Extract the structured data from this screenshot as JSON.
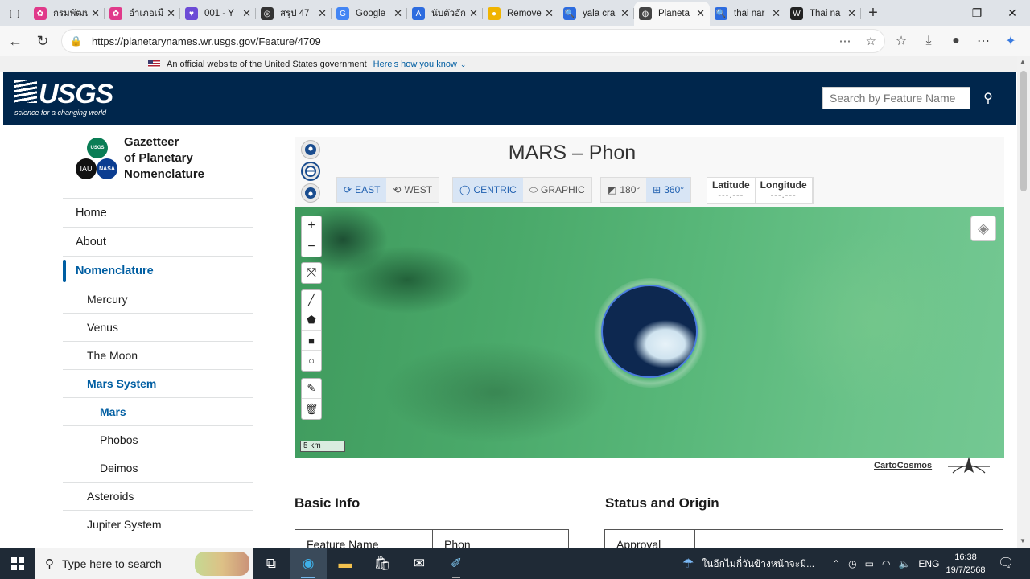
{
  "browser": {
    "tabs": [
      {
        "title": "กรมพัฒนา",
        "fav_color": "#e03a8a",
        "fav_glyph": "✿"
      },
      {
        "title": "อำเภอเมือง",
        "fav_color": "#e03a8a",
        "fav_glyph": "✿"
      },
      {
        "title": "001 - Y",
        "fav_color": "#6c4bd6",
        "fav_glyph": "♥"
      },
      {
        "title": "สรุป 47",
        "fav_color": "#333333",
        "fav_glyph": "◎"
      },
      {
        "title": "Google",
        "fav_color": "#4285f4",
        "fav_glyph": "G"
      },
      {
        "title": "นับตัวอักษร",
        "fav_color": "#2d6cdf",
        "fav_glyph": "A"
      },
      {
        "title": "Remove",
        "fav_color": "#f0b400",
        "fav_glyph": "●"
      },
      {
        "title": "yala cra",
        "fav_color": "#2d6cdf",
        "fav_glyph": "🔍"
      },
      {
        "title": "Planeta",
        "fav_color": "#444444",
        "fav_glyph": "◍",
        "active": true
      },
      {
        "title": "thai nar",
        "fav_color": "#2d6cdf",
        "fav_glyph": "🔍"
      },
      {
        "title": "Thai na",
        "fav_color": "#222222",
        "fav_glyph": "W"
      }
    ],
    "url": "https://planetarynames.wr.usgs.gov/Feature/4709"
  },
  "govbanner": {
    "text": "An official website of the United States government",
    "link": "Here's how you know"
  },
  "header": {
    "logo_text": "USGS",
    "logo_tagline": "science for a changing world",
    "search_placeholder": "Search by Feature Name"
  },
  "sidebar": {
    "title_lines": [
      "Gazetteer",
      "of Planetary",
      "Nomenclature"
    ],
    "logos": [
      "USGS",
      "IAU",
      "NASA"
    ],
    "items": [
      {
        "label": "Home",
        "level": 0
      },
      {
        "label": "About",
        "level": 0
      },
      {
        "label": "Nomenclature",
        "level": 0,
        "current": true
      },
      {
        "label": "Mercury",
        "level": 1
      },
      {
        "label": "Venus",
        "level": 1
      },
      {
        "label": "The Moon",
        "level": 1
      },
      {
        "label": "Mars System",
        "level": 1,
        "current": true
      },
      {
        "label": "Mars",
        "level": 2,
        "current": true
      },
      {
        "label": "Phobos",
        "level": 2
      },
      {
        "label": "Deimos",
        "level": 2
      },
      {
        "label": "Asteroids",
        "level": 1
      },
      {
        "label": "Jupiter System",
        "level": 1
      }
    ]
  },
  "map_panel": {
    "feature_title": "MARS – Phon",
    "direction": {
      "east": "EAST",
      "west": "WEST",
      "selected": "EAST"
    },
    "latitude_type": {
      "centric": "CENTRIC",
      "graphic": "GRAPHIC",
      "selected": "CENTRIC"
    },
    "longitude_range": {
      "r180": "180°",
      "r360": "360°",
      "selected": "360°"
    },
    "latitude_label": "Latitude",
    "latitude_value": "---.---",
    "longitude_label": "Longitude",
    "longitude_value": "---.---",
    "scale_label": "5 km",
    "attribution": "CartoCosmos",
    "zoom_in": "+",
    "zoom_out": "−"
  },
  "basic_info": {
    "heading": "Basic Info",
    "feature_name_label": "Feature Name",
    "feature_name_value": "Phon"
  },
  "status_origin": {
    "heading": "Status and Origin",
    "approval_label": "Approval"
  },
  "taskbar": {
    "search_placeholder": "Type here to search",
    "weather_text": "ในอีกไม่กี่วันข้างหน้าจะมี...",
    "language": "ENG",
    "time": "16:38",
    "date": "19/7/2568"
  }
}
